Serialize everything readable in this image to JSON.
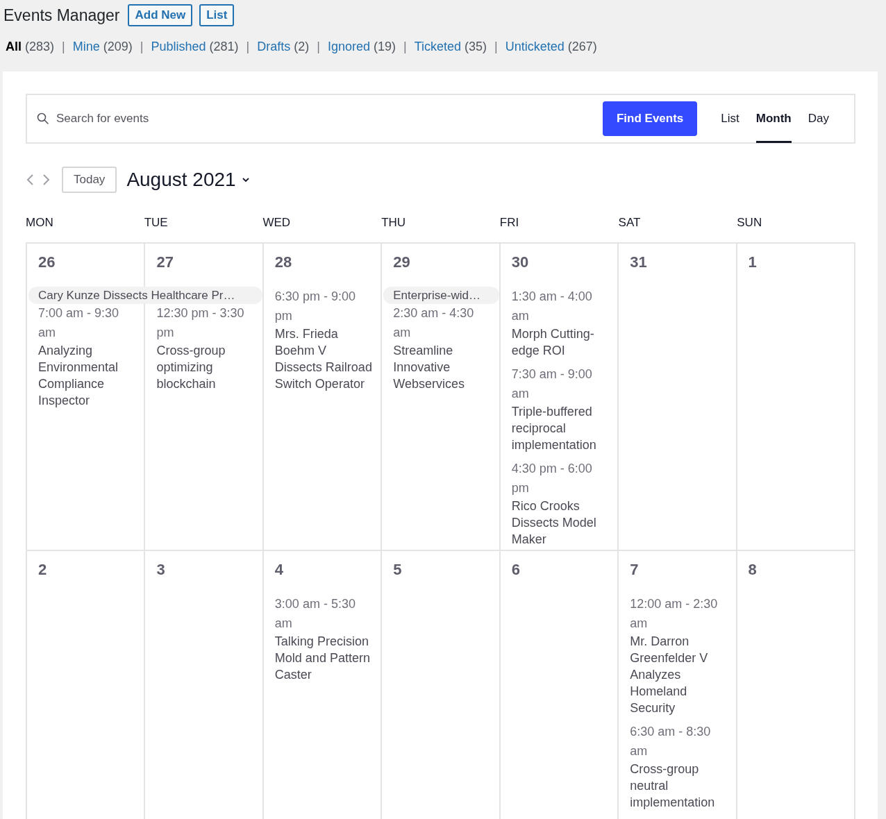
{
  "header": {
    "title": "Events Manager",
    "buttons": [
      "Add New",
      "List"
    ]
  },
  "filters": {
    "separator": "|",
    "items": [
      {
        "label": "All",
        "count": "(283)",
        "selected": true
      },
      {
        "label": "Mine",
        "count": "(209)",
        "selected": false
      },
      {
        "label": "Published",
        "count": "(281)",
        "selected": false
      },
      {
        "label": "Drafts",
        "count": "(2)",
        "selected": false
      },
      {
        "label": "Ignored",
        "count": "(19)",
        "selected": false
      },
      {
        "label": "Ticketed",
        "count": "(35)",
        "selected": false
      },
      {
        "label": "Unticketed",
        "count": "(267)",
        "selected": false
      }
    ]
  },
  "search": {
    "placeholder": "Search for events",
    "button": "Find Events"
  },
  "views": [
    {
      "label": "List",
      "selected": false
    },
    {
      "label": "Month",
      "selected": true
    },
    {
      "label": "Day",
      "selected": false
    }
  ],
  "today_button": "Today",
  "month_label": "August 2021",
  "weekdays": [
    "MON",
    "TUE",
    "WED",
    "THU",
    "FRI",
    "SAT",
    "SUN"
  ],
  "weeks": [
    {
      "days": [
        {
          "date": "26",
          "bar": "Cary Kunze Dissects Healthcare Pr…",
          "events": [
            {
              "time": "7:00 am - 9:30 am",
              "title": "Analyzing Environmental Compliance Inspector"
            }
          ]
        },
        {
          "date": "27",
          "bar_continues": true,
          "events": [
            {
              "time": "12:30 pm - 3:30 pm",
              "title": "Cross-group optimizing blockchain"
            }
          ]
        },
        {
          "date": "28",
          "events": [
            {
              "time": "6:30 pm - 9:00 pm",
              "title": "Mrs. Frieda Boehm V Dissects Railroad Switch Operator"
            }
          ]
        },
        {
          "date": "29",
          "bar": "Enterprise-wid…",
          "events": [
            {
              "time": "2:30 am - 4:30 am",
              "title": "Streamline Innovative Webservices"
            }
          ]
        },
        {
          "date": "30",
          "events": [
            {
              "time": "1:30 am - 4:00 am",
              "title": "Morph Cutting-edge ROI"
            },
            {
              "time": "7:30 am - 9:00 am",
              "title": "Triple-buffered reciprocal implementation"
            },
            {
              "time": "4:30 pm - 6:00 pm",
              "title": "Rico Crooks Dissects Model Maker"
            }
          ]
        },
        {
          "date": "31"
        },
        {
          "date": "1"
        }
      ]
    },
    {
      "days": [
        {
          "date": "2"
        },
        {
          "date": "3"
        },
        {
          "date": "4",
          "events": [
            {
              "time": "3:00 am - 5:30 am",
              "title": "Talking Precision Mold and Pattern Caster"
            }
          ]
        },
        {
          "date": "5"
        },
        {
          "date": "6"
        },
        {
          "date": "7",
          "events": [
            {
              "time": "12:00 am - 2:30 am",
              "title": "Mr. Darron Greenfelder V Analyzes Homeland Security"
            },
            {
              "time": "6:30 am - 8:30 am",
              "title": "Cross-group neutral implementation"
            }
          ]
        },
        {
          "date": "8"
        }
      ]
    }
  ]
}
